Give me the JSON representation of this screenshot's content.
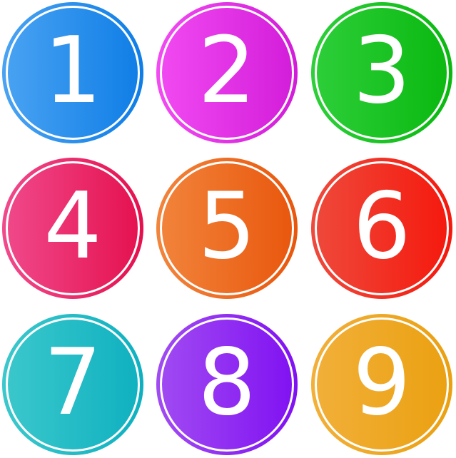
{
  "badges": [
    {
      "label": "1",
      "color_from": "#4aa3f2",
      "color_to": "#0e7de6"
    },
    {
      "label": "2",
      "color_from": "#f24bf2",
      "color_to": "#d21cd9"
    },
    {
      "label": "3",
      "color_from": "#2ecf3a",
      "color_to": "#09b80f"
    },
    {
      "label": "4",
      "color_from": "#f04a8c",
      "color_to": "#e5104e"
    },
    {
      "label": "5",
      "color_from": "#f2853c",
      "color_to": "#e8560c"
    },
    {
      "label": "6",
      "color_from": "#ee4a3c",
      "color_to": "#f5180c"
    },
    {
      "label": "7",
      "color_from": "#3cc8cc",
      "color_to": "#0eb0c0"
    },
    {
      "label": "8",
      "color_from": "#a14cf2",
      "color_to": "#8010f2"
    },
    {
      "label": "9",
      "color_from": "#f2b03a",
      "color_to": "#eaa010"
    }
  ]
}
